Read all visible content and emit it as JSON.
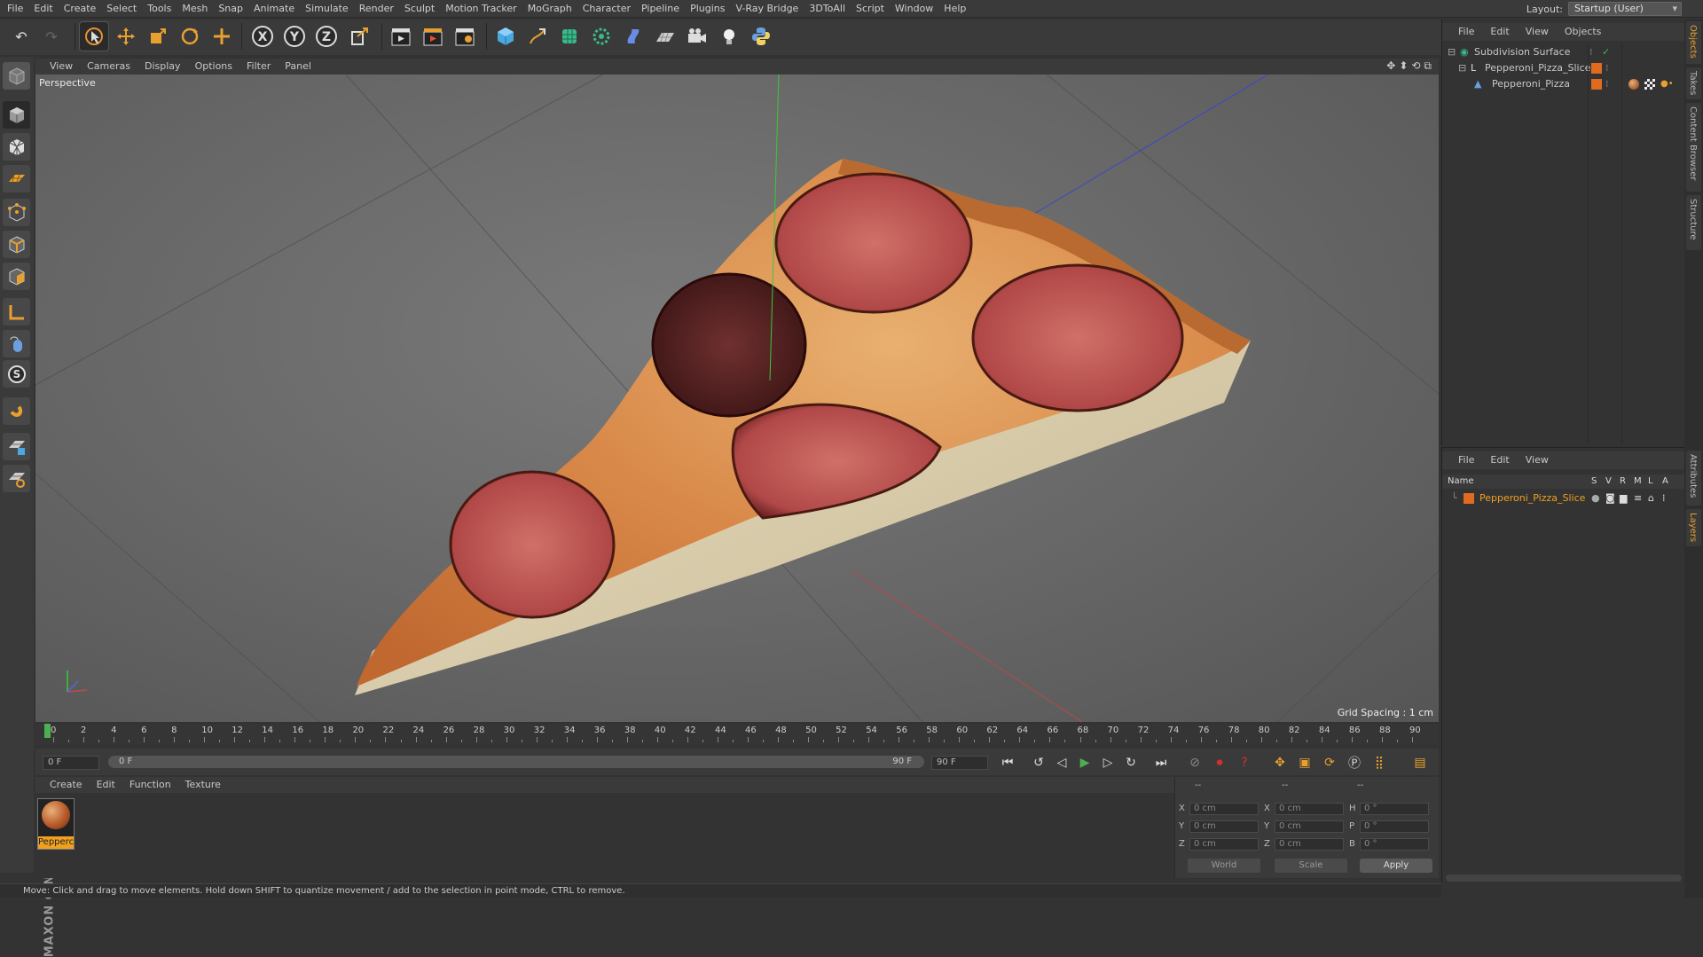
{
  "menubar": {
    "items": [
      "File",
      "Edit",
      "Create",
      "Select",
      "Tools",
      "Mesh",
      "Snap",
      "Animate",
      "Simulate",
      "Render",
      "Sculpt",
      "Motion Tracker",
      "MoGraph",
      "Character",
      "Pipeline",
      "Plugins",
      "V-Ray Bridge",
      "3DToAll",
      "Script",
      "Window",
      "Help"
    ],
    "layout_label": "Layout:",
    "layout_value": "Startup (User)"
  },
  "toolbar": {
    "axis_labels": [
      "X",
      "Y",
      "Z"
    ],
    "icons": [
      "undo-icon",
      "redo-icon",
      "live-selection-icon",
      "move-icon",
      "scale-icon",
      "rotate-icon",
      "add-icon",
      "x-axis-icon",
      "y-axis-icon",
      "z-axis-icon",
      "coordinate-system-icon",
      "render-view-icon",
      "render-picture-viewer-icon",
      "edit-render-settings-icon",
      "cube-icon",
      "pen-icon",
      "subdivision-icon",
      "array-icon",
      "deformer-icon",
      "floor-icon",
      "camera-icon",
      "light-icon",
      "python-icon"
    ]
  },
  "viewport": {
    "menu": [
      "View",
      "Cameras",
      "Display",
      "Options",
      "Filter",
      "Panel"
    ],
    "label": "Perspective",
    "grid_spacing": "Grid Spacing : 1 cm"
  },
  "timeline": {
    "ticks": [
      "0",
      "2",
      "4",
      "6",
      "8",
      "10",
      "12",
      "14",
      "16",
      "18",
      "20",
      "22",
      "24",
      "26",
      "28",
      "30",
      "32",
      "34",
      "36",
      "38",
      "40",
      "42",
      "44",
      "46",
      "48",
      "50",
      "52",
      "54",
      "56",
      "58",
      "60",
      "62",
      "64",
      "66",
      "68",
      "70",
      "72",
      "74",
      "76",
      "78",
      "80",
      "82",
      "84",
      "86",
      "88",
      "90"
    ],
    "current_frame": "0 F"
  },
  "transport": {
    "start_field": "0 F",
    "range_start": "0 F",
    "range_end": "90 F",
    "end_field": "90 F"
  },
  "material_manager": {
    "menu": [
      "Create",
      "Edit",
      "Function",
      "Texture"
    ],
    "material_name": "Pepperc"
  },
  "coordinates": {
    "header": [
      "--",
      "--",
      "--"
    ],
    "rows": [
      {
        "a": "X",
        "av": "0 cm",
        "b": "X",
        "bv": "0 cm",
        "c": "H",
        "cv": "0 °"
      },
      {
        "a": "Y",
        "av": "0 cm",
        "b": "Y",
        "bv": "0 cm",
        "c": "P",
        "cv": "0 °"
      },
      {
        "a": "Z",
        "av": "0 cm",
        "b": "Z",
        "bv": "0 cm",
        "c": "B",
        "cv": "0 °"
      }
    ],
    "mode1": "World",
    "mode2": "Scale",
    "apply": "Apply"
  },
  "status": {
    "text": "Move: Click and drag to move elements. Hold down SHIFT to quantize movement / add to the selection in point mode, CTRL to remove."
  },
  "objects_panel": {
    "menu": [
      "File",
      "Edit",
      "View",
      "Objects"
    ],
    "items": [
      {
        "name": "Subdivision Surface",
        "level": 0
      },
      {
        "name": "Pepperoni_Pizza_Slice",
        "level": 1
      },
      {
        "name": "Pepperoni_Pizza",
        "level": 2
      }
    ]
  },
  "layers_panel": {
    "menu": [
      "File",
      "Edit",
      "View"
    ],
    "header_name": "Name",
    "flags": [
      "S",
      "V",
      "R",
      "M",
      "L",
      "A"
    ],
    "layer": "Pepperoni_Pizza_Slice"
  },
  "side_tabs": {
    "top": [
      "Objects",
      "Takes",
      "Content Browser",
      "Structure"
    ],
    "bottom": [
      "Attributes",
      "Layers"
    ]
  },
  "colors": {
    "accent_orange": "#f0a020",
    "play_green": "#4caf50",
    "stop_red": "#d03030"
  }
}
